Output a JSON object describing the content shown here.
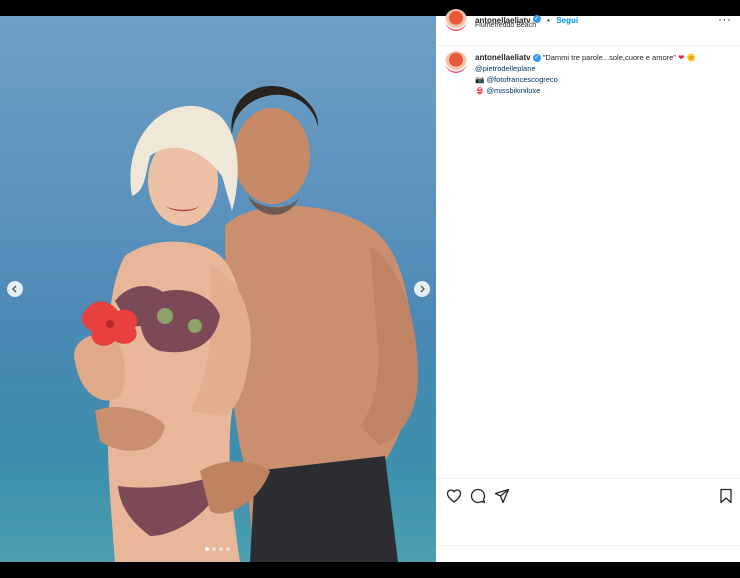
{
  "post": {
    "username": "antonellaeliatv",
    "follow_separator": "•",
    "follow_label": "Segui",
    "location": "Fiumefreddo Beach",
    "verified": true
  },
  "caption": {
    "username": "antonellaeliatv",
    "text": "\"Dammi tre parole...sole,cuore e amore\"",
    "heart_emoji": "❤",
    "sun_emoji": "🌞",
    "line2_mention": "@pietrodelleplane",
    "line3_emoji": "📷",
    "line3_mention": "@fotofrancescogreco",
    "line4_emoji": "👙",
    "line4_mention": "@missbikiniluxe"
  },
  "carousel": {
    "dots": 4,
    "active_index": 0
  },
  "colors": {
    "link": "#00376b",
    "follow": "#0095f6",
    "verified": "#3897f0"
  },
  "icons": [
    "like-heart-icon",
    "comment-icon",
    "share-icon",
    "bookmark-icon",
    "more-options-icon",
    "chevron-left-icon",
    "chevron-right-icon",
    "verified-badge-icon"
  ]
}
